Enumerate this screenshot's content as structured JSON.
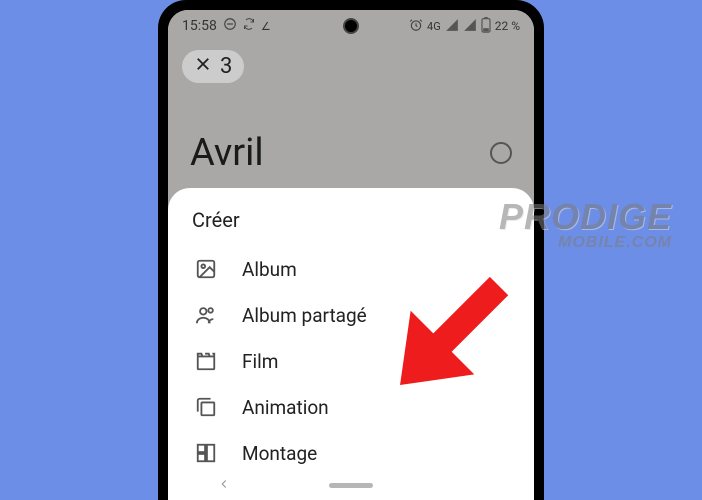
{
  "status": {
    "time": "15:58",
    "network_label": "4G",
    "battery_text": "22 %"
  },
  "selection": {
    "count": "3"
  },
  "month": {
    "title": "Avril"
  },
  "sheet": {
    "title": "Créer",
    "items": [
      {
        "label": "Album"
      },
      {
        "label": "Album partagé"
      },
      {
        "label": "Film"
      },
      {
        "label": "Animation"
      },
      {
        "label": "Montage"
      }
    ]
  },
  "watermark": {
    "line1": "PRODIGE",
    "line2": "MOBILE.COM"
  }
}
